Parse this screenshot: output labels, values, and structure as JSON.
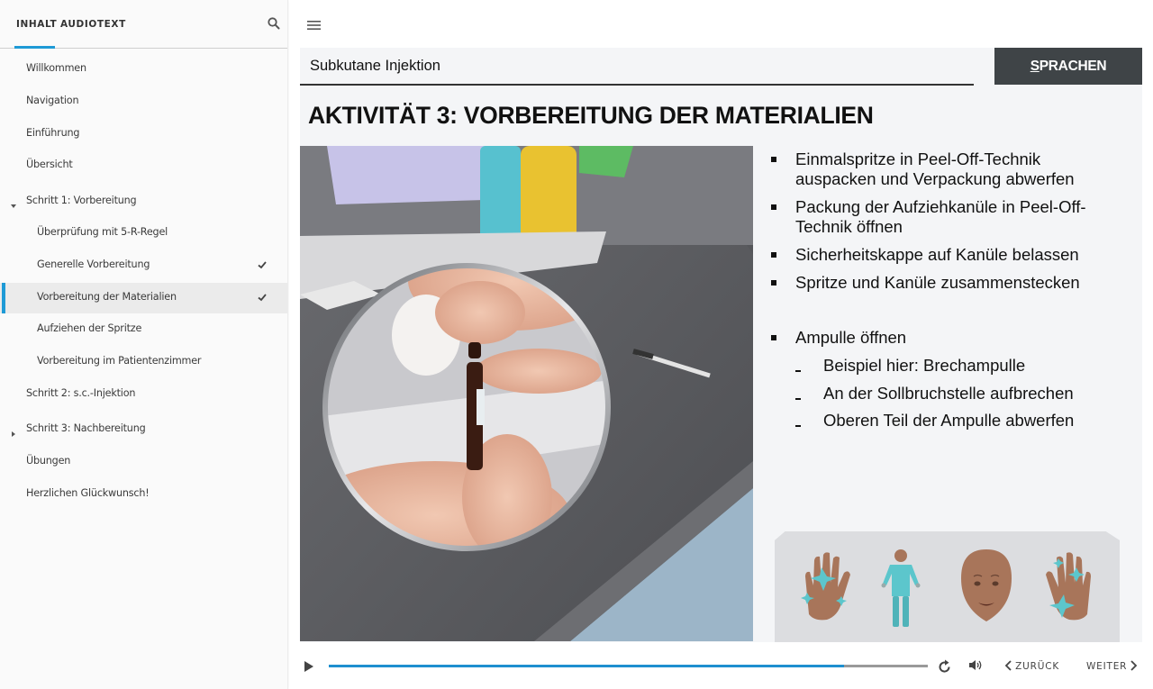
{
  "sidebar": {
    "tabs": [
      {
        "label": "INHALT",
        "active": true
      },
      {
        "label": "AUDIOTEXT",
        "active": false
      }
    ],
    "search_icon": "search-icon",
    "items": [
      {
        "label": "Willkommen",
        "level": 0
      },
      {
        "label": "Navigation",
        "level": 0
      },
      {
        "label": "Einführung",
        "level": 0
      },
      {
        "label": "Übersicht",
        "level": 0
      },
      {
        "label": "Schritt 1: Vorbereitung",
        "level": 0,
        "caret": "expanded"
      },
      {
        "label": "Überprüfung mit 5-R-Regel",
        "level": 1
      },
      {
        "label": "Generelle Vorbereitung",
        "level": 1,
        "completed": true
      },
      {
        "label": "Vorbereitung der Materialien",
        "level": 1,
        "completed": true,
        "active": true
      },
      {
        "label": "Aufziehen der Spritze",
        "level": 1
      },
      {
        "label": "Vorbereitung im Patientenzimmer",
        "level": 1
      },
      {
        "label": "Schritt 2: s.c.-Injektion",
        "level": 0
      },
      {
        "label": "Schritt 3: Nachbereitung",
        "level": 0,
        "caret": "collapsed"
      },
      {
        "label": "Übungen",
        "level": 0
      },
      {
        "label": "Herzlichen Glückwunsch!",
        "level": 0
      }
    ]
  },
  "header": {
    "menu_icon": "hamburger-menu-icon"
  },
  "slide": {
    "course_title": "Subkutane Injektion",
    "languages_button": {
      "accesskey_letter": "S",
      "rest": "PRACHEN"
    },
    "heading": "AKTIVITÄT 3: VORBEREITUNG DER MATERIALIEN",
    "image_alt": "Hände brechen eine Ampulle an der Sollbruchstelle mit einem Tupfer auf",
    "bullets": [
      {
        "lines": [
          "Einmalspritze in Peel-Off-Technik",
          "auspacken und Verpackung abwerfen"
        ],
        "sub": false
      },
      {
        "lines": [
          "Packung der Aufziehkanüle in Peel-Off-",
          "Technik öffnen"
        ],
        "sub": false
      },
      {
        "lines": [
          "Sicherheitskappe auf Kanüle belassen"
        ],
        "sub": false
      },
      {
        "lines": [
          "Spritze und Kanüle zusammenstecken"
        ],
        "sub": false
      },
      {
        "lines": [
          "Ampulle öffnen"
        ],
        "sub": false
      },
      {
        "lines": [
          "Beispiel hier: Brechampulle"
        ],
        "sub": true
      },
      {
        "lines": [
          "An der Sollbruchstelle aufbrechen"
        ],
        "sub": true
      },
      {
        "lines": [
          "Oberen Teil der Ampulle abwerfen"
        ],
        "sub": true
      }
    ],
    "hygiene_icons": [
      "clean-hand-icon",
      "staff-clothing-icon",
      "patient-face-icon",
      "clean-hand-icon"
    ],
    "colors": {
      "accent": "#1e9ad6",
      "button_dark": "#3f4447",
      "hygiene_teal": "#5cc6cc",
      "skin": "#a8755a"
    }
  },
  "player": {
    "progress": 0.86,
    "replay_icon": "replay-icon",
    "volume_icon": "volume-icon",
    "back_label": "ZURÜCK",
    "next_label": "WEITER"
  }
}
